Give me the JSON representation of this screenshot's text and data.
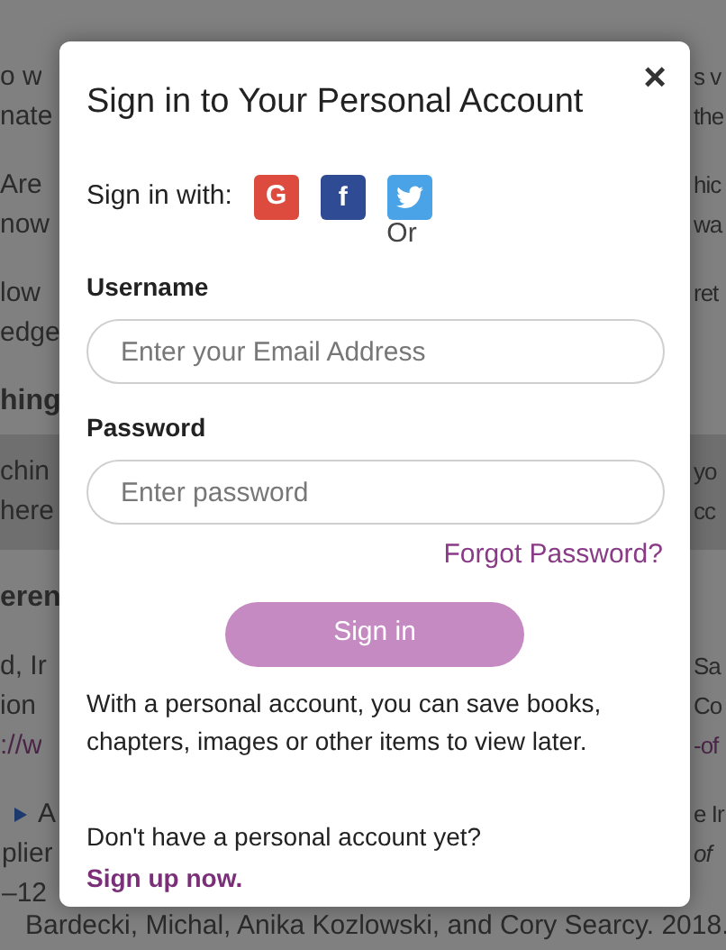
{
  "background": {
    "paragraphs": [
      {
        "kind": "text",
        "lines": [
          {
            "left": "o w",
            "right": "s v"
          },
          {
            "left": "nate",
            "right": "the"
          }
        ]
      },
      {
        "kind": "text",
        "lines": [
          {
            "left": "Are",
            "right": "hic"
          },
          {
            "left": "now",
            "right": "wa"
          }
        ]
      },
      {
        "kind": "text",
        "lines": [
          {
            "left": "low",
            "right": "ret"
          },
          {
            "left": "edge"
          }
        ]
      },
      {
        "kind": "heading",
        "lines": [
          {
            "left": "hing"
          }
        ]
      },
      {
        "kind": "band",
        "lines": [
          {
            "left": "chin",
            "right": "yo"
          },
          {
            "left": "here",
            "right": "cc"
          }
        ]
      },
      {
        "kind": "heading",
        "lines": [
          {
            "left": "eren"
          }
        ]
      },
      {
        "kind": "refs",
        "lines": [
          {
            "left": "d, Ir",
            "right": "Sa"
          },
          {
            "left": "ion",
            "right": "Co"
          },
          {
            "left": "://w",
            "right": "-of",
            "link": true
          }
        ]
      },
      {
        "kind": "bullet",
        "lines": [
          {
            "left": "A",
            "right": "e Ir"
          },
          {
            "left": "plier",
            "right": "of",
            "italic": true
          },
          {
            "left": "–12"
          }
        ]
      },
      {
        "kind": "bullet",
        "lines": [
          {
            "left": "Bardecki, Michal, Anika Kozlowski, and Cory Searcy. 2018."
          }
        ]
      }
    ]
  },
  "dialog": {
    "title": "Sign in to Your Personal Account",
    "close": "×",
    "social_label": "Sign in with:",
    "social": [
      {
        "kind": "google",
        "label": "G"
      },
      {
        "kind": "facebook",
        "label": "f"
      },
      {
        "kind": "twitter"
      }
    ],
    "or": "Or",
    "fields": [
      {
        "label": "Username",
        "placeholder": "Enter your Email Address"
      },
      {
        "label": "Password",
        "placeholder": "Enter password"
      }
    ],
    "forgot": "Forgot Password?",
    "submit": "Sign in",
    "info": "With a personal account, you can save books, chapters, images or other items to view later.",
    "signup_prompt": "Don't have a personal account yet?",
    "signup_link": "Sign up now."
  }
}
